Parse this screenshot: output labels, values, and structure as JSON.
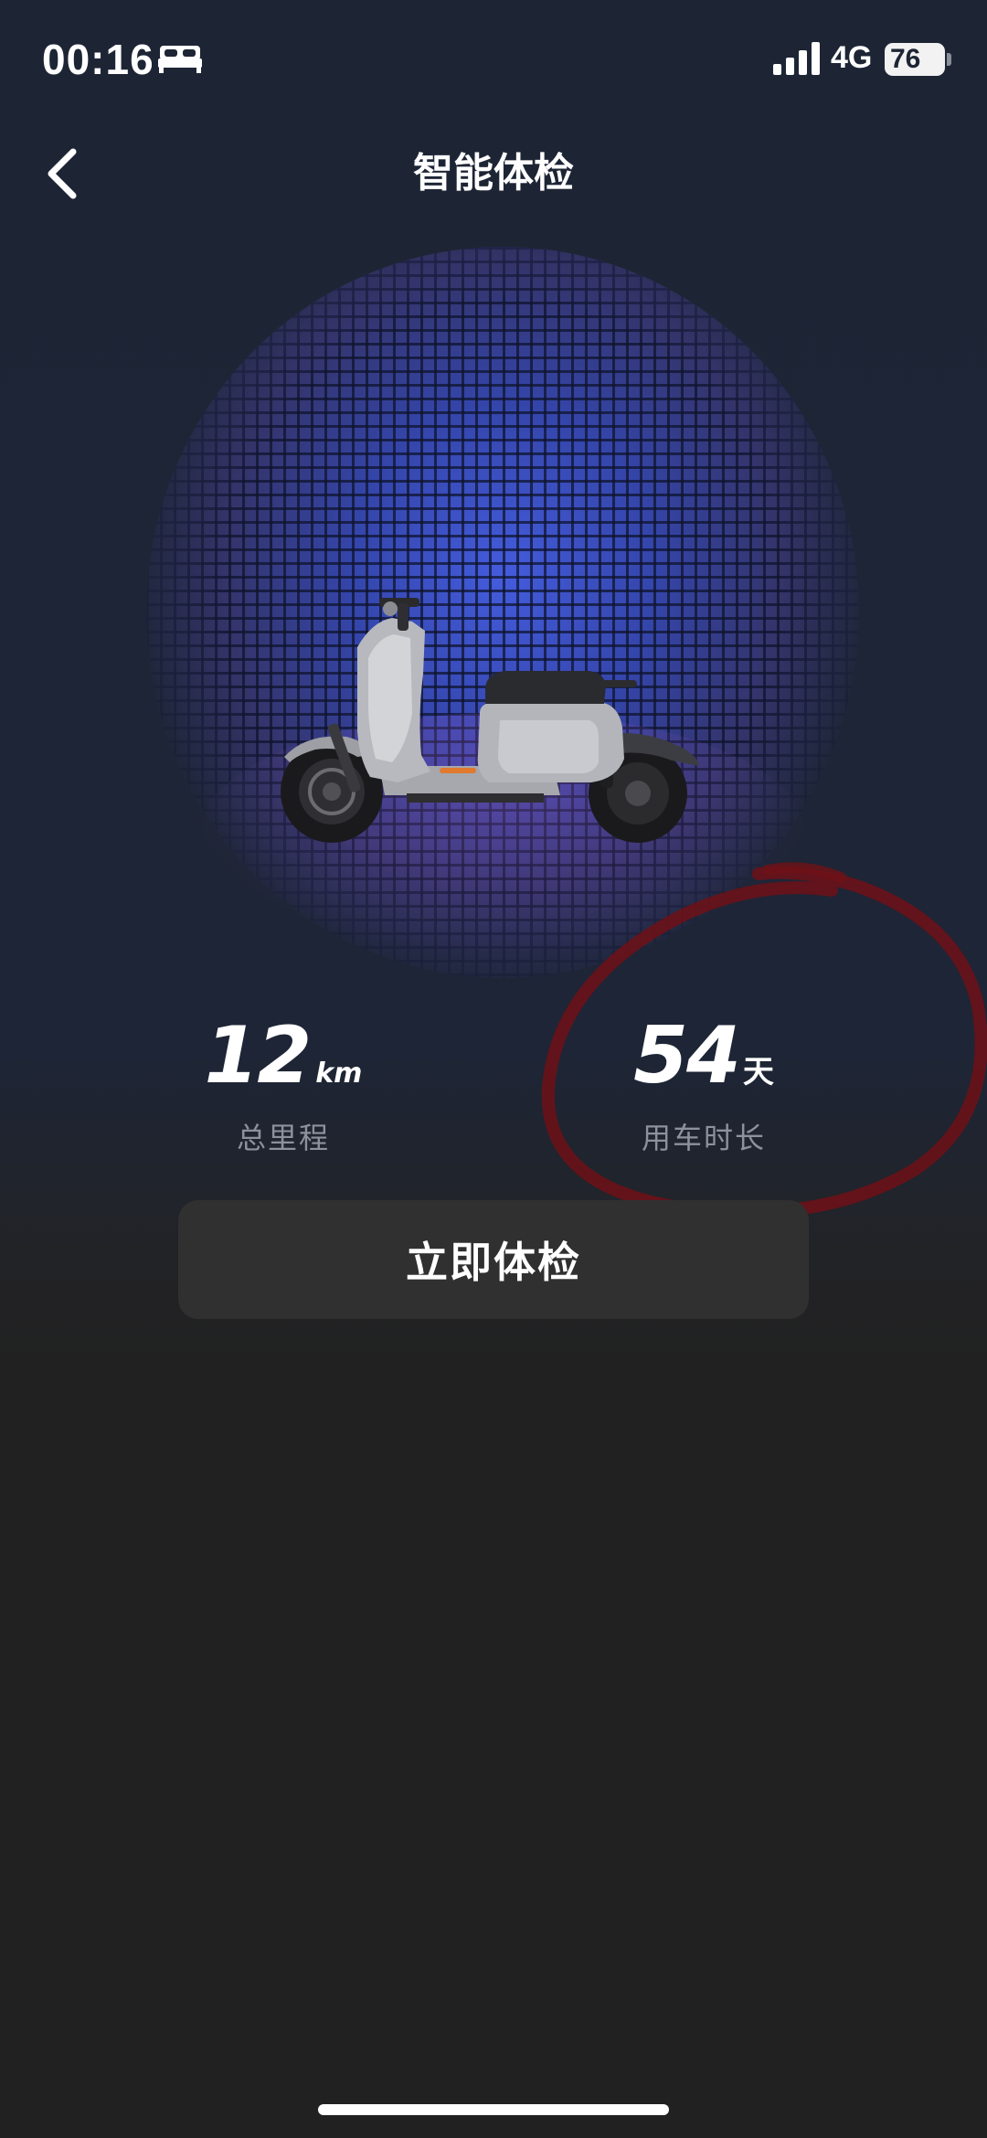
{
  "status_bar": {
    "time": "00:16",
    "network": "4G",
    "battery": "76"
  },
  "header": {
    "title": "智能体检"
  },
  "stats": {
    "mileage": {
      "value": "12",
      "unit": "km",
      "label": "总里程"
    },
    "usage_days": {
      "value": "54",
      "unit": "天",
      "label": "用车时长"
    }
  },
  "actions": {
    "check_now_label": "立即体检"
  },
  "colors": {
    "background_top": "#1d2535",
    "background_bottom": "#212121",
    "button_bg": "#303030",
    "label_gray": "#8c919b",
    "annotation_red": "#7a1418",
    "hero_blue": "#465fe6"
  },
  "icons": {
    "bed": "bed-icon",
    "signal": "signal-icon",
    "battery": "battery-icon",
    "back": "chevron-left-icon"
  }
}
